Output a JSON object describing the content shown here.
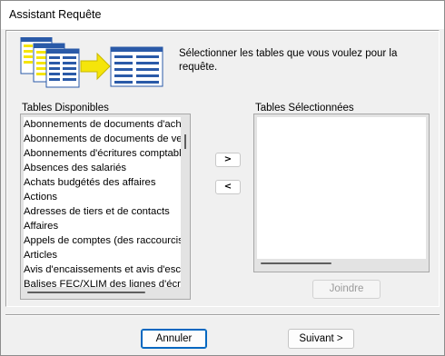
{
  "window": {
    "title": "Assistant Requête"
  },
  "instructions": "Sélectionner les tables que vous voulez pour la requête.",
  "available": {
    "label": "Tables Disponibles",
    "items": [
      "Abonnements de documents d'acha",
      "Abonnements de documents de ver",
      "Abonnements d'écritures comptable",
      "Absences des salariés",
      "Achats budgétés des affaires",
      "Actions",
      "Adresses de tiers et de contacts",
      "Affaires",
      "Appels de comptes (des raccourcis d",
      "Articles",
      "Avis d'encaissements et avis d'escon",
      "Balises FEC/XLIM des lignes d'écr..."
    ]
  },
  "selected": {
    "label": "Tables Sélectionnées",
    "items": []
  },
  "transfer": {
    "add_label": ">",
    "remove_label": "<"
  },
  "joindre_label": "Joindre",
  "footer": {
    "cancel_label": "Annuler",
    "next_label": "Suivant >"
  },
  "colors": {
    "accent": "#0067c0",
    "yellow": "#f5e50a",
    "table_blue": "#2a5aa8"
  }
}
